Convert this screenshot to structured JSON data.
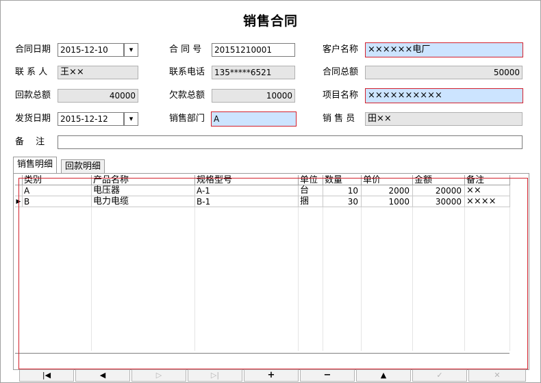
{
  "window": {
    "title": "销售合同"
  },
  "form": {
    "contract_date": {
      "label": "合同日期",
      "value": "2015-12-10",
      "dropdown": "▾"
    },
    "contract_no": {
      "label": "合 同 号",
      "value": "20151210001"
    },
    "customer": {
      "label": "客户名称",
      "value": "××××××电厂"
    },
    "contact": {
      "label": "联 系 人",
      "value": "王××"
    },
    "phone": {
      "label": "联系电话",
      "value": "135*****6521"
    },
    "total": {
      "label": "合同总额",
      "value": "50000"
    },
    "received": {
      "label": "回款总额",
      "value": "40000"
    },
    "owed": {
      "label": "欠款总额",
      "value": "10000"
    },
    "project": {
      "label": "项目名称",
      "value": "××××××××××"
    },
    "ship_date": {
      "label": "发货日期",
      "value": "2015-12-12",
      "dropdown": "▾"
    },
    "dept": {
      "label": "销售部门",
      "value": "A"
    },
    "salesman": {
      "label": "销 售 员",
      "value": "田××"
    },
    "remark": {
      "label": "备　 注",
      "value": ""
    }
  },
  "tabs": [
    {
      "label": "销售明细",
      "active": true
    },
    {
      "label": "回款明细",
      "active": false
    }
  ],
  "grid": {
    "columns": [
      "类别",
      "产品名称",
      "规格型号",
      "单位",
      "数量",
      "单价",
      "金额",
      "备注"
    ],
    "rows": [
      [
        "A",
        "电压器",
        "A-1",
        "台",
        "10",
        "2000",
        "20000",
        "××"
      ],
      [
        "B",
        "电力电缆",
        "B-1",
        "捆",
        "30",
        "1000",
        "30000",
        "××××"
      ]
    ],
    "current_row_marker": "▶"
  },
  "navigator": [
    {
      "name": "first",
      "glyph": "|◀",
      "enabled": true
    },
    {
      "name": "prior",
      "glyph": "◀",
      "enabled": true
    },
    {
      "name": "next",
      "glyph": "▷",
      "enabled": false
    },
    {
      "name": "last",
      "glyph": "▷|",
      "enabled": false
    },
    {
      "name": "insert",
      "glyph": "+",
      "enabled": true
    },
    {
      "name": "delete",
      "glyph": "−",
      "enabled": true
    },
    {
      "name": "edit",
      "glyph": "▲",
      "enabled": true
    },
    {
      "name": "post",
      "glyph": "✓",
      "enabled": false
    },
    {
      "name": "cancel",
      "glyph": "✕",
      "enabled": false
    }
  ]
}
